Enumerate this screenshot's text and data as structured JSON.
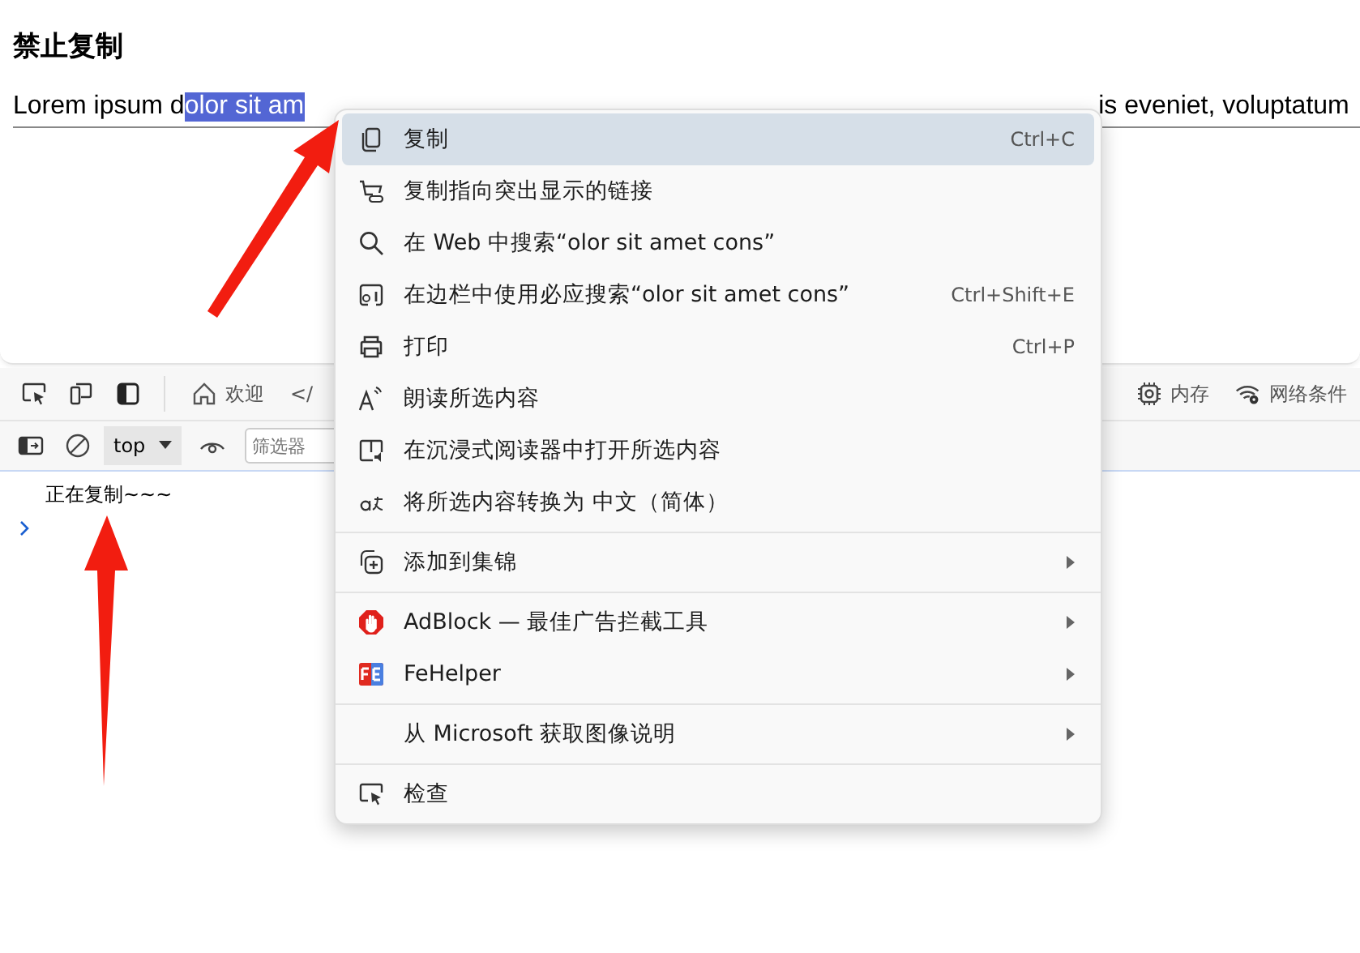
{
  "page": {
    "heading": "禁止复制",
    "paragraph": {
      "before": "Lorem ipsum d",
      "selected": "olor sit am",
      "after": "is eveniet, voluptatum"
    }
  },
  "devtools": {
    "toolbar_left": [
      {
        "kind": "inspect"
      },
      {
        "kind": "device"
      },
      {
        "kind": "panel"
      }
    ],
    "tabs": [
      {
        "label": "欢迎",
        "kind": "home"
      },
      {
        "label": "</",
        "kind": "none"
      }
    ],
    "tabs_right": [
      {
        "label": "内存",
        "kind": "chip"
      },
      {
        "label": "网络条件",
        "kind": "wifi"
      }
    ],
    "console_toolbar": {
      "context": "top",
      "filter_placeholder": "筛选器"
    },
    "console": {
      "messages": [
        "正在复制~~~"
      ]
    }
  },
  "context_menu": {
    "groups": [
      [
        {
          "label": "复制",
          "kind": "copy",
          "shortcut": "Ctrl+C",
          "selected": true,
          "submenu": false
        },
        {
          "label": "复制指向突出显示的链接",
          "kind": "link",
          "selected": false,
          "submenu": false
        },
        {
          "label": "在 Web 中搜索“olor sit amet cons”",
          "kind": "search",
          "selected": false,
          "submenu": false
        },
        {
          "label": "在边栏中使用必应搜索“olor sit amet cons”",
          "kind": "sidebar-search",
          "shortcut": "Ctrl+Shift+E",
          "selected": false,
          "submenu": false
        },
        {
          "label": "打印",
          "kind": "print",
          "shortcut": "Ctrl+P",
          "selected": false,
          "submenu": false
        },
        {
          "label": "朗读所选内容",
          "kind": "read",
          "selected": false,
          "submenu": false
        },
        {
          "label": "在沉浸式阅读器中打开所选内容",
          "kind": "reader",
          "selected": false,
          "submenu": false
        },
        {
          "label": "将所选内容转换为 中文（简体）",
          "kind": "translate",
          "selected": false,
          "submenu": false
        }
      ],
      [
        {
          "label": "添加到集锦",
          "kind": "collection",
          "selected": false,
          "submenu": true
        }
      ],
      [
        {
          "label": "AdBlock — 最佳广告拦截工具",
          "kind": "adblock",
          "selected": false,
          "submenu": true
        },
        {
          "label": "FeHelper",
          "kind": "fehelper",
          "selected": false,
          "submenu": true
        }
      ],
      [
        {
          "label": "从 Microsoft 获取图像说明",
          "kind": "none",
          "selected": false,
          "submenu": true
        }
      ],
      [
        {
          "label": "检查",
          "kind": "inspect",
          "selected": false,
          "submenu": false
        }
      ]
    ]
  }
}
